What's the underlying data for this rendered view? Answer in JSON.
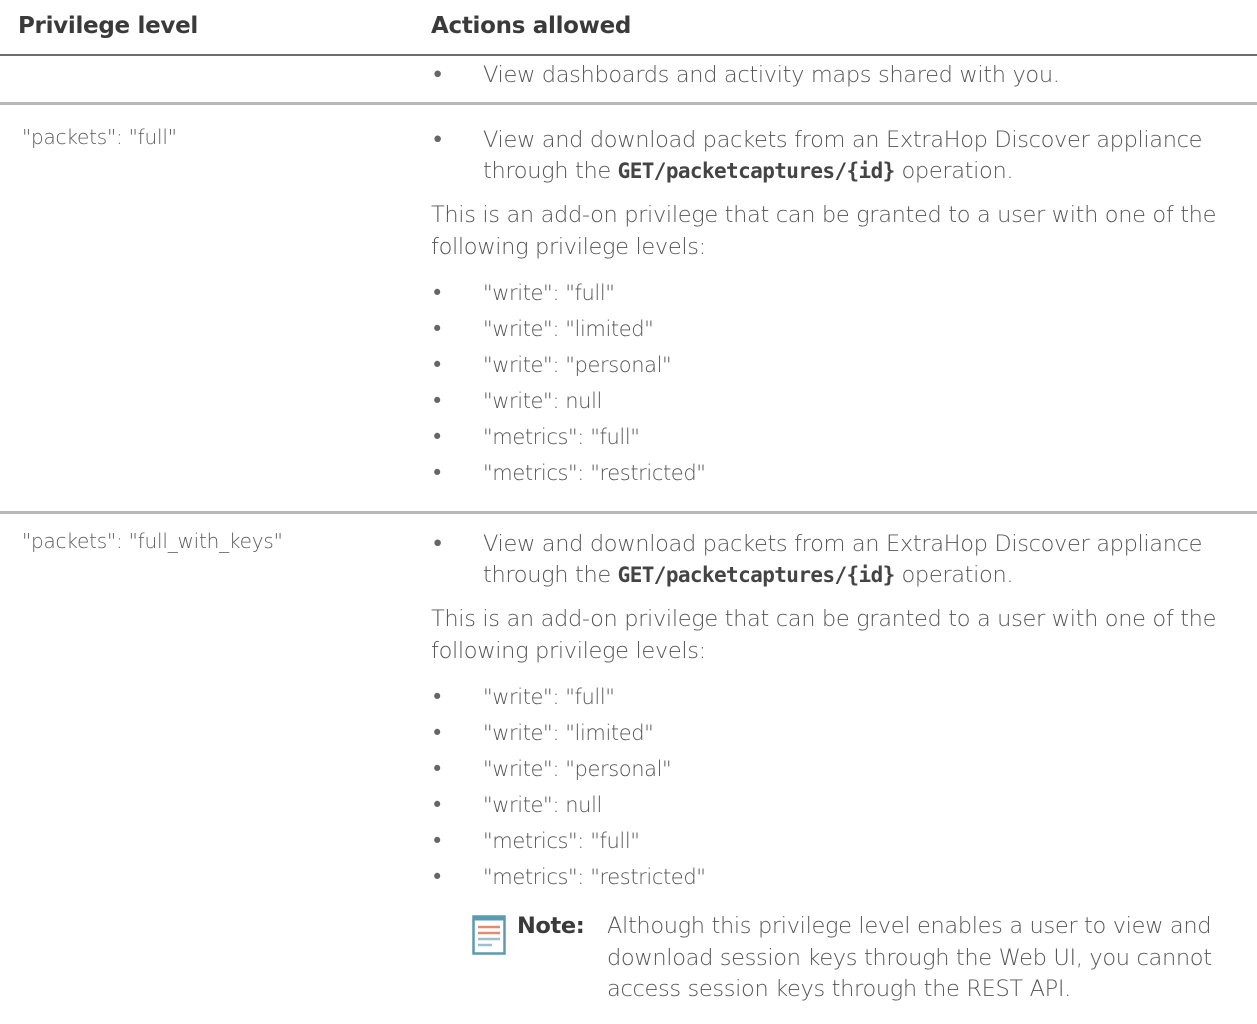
{
  "header": {
    "col_privilege": "Privilege level",
    "col_actions": "Actions allowed"
  },
  "row0": {
    "bullet": "View dashboards and activity maps shared with you."
  },
  "row1": {
    "privilege": "\"packets\": \"full\"",
    "bullet_pre": "View and download packets from an ExtraHop Discover appliance through the ",
    "bullet_code": "GET/packetcaptures/{id}",
    "bullet_post": " operation.",
    "para": "This is an add-on privilege that can be granted to a user with one of the following privilege levels:",
    "levels": [
      "\"write\": \"full\"",
      "\"write\": \"limited\"",
      "\"write\": \"personal\"",
      "\"write\": null",
      "\"metrics\": \"full\"",
      "\"metrics\": \"restricted\""
    ]
  },
  "row2": {
    "privilege": "\"packets\": \"full_with_keys\"",
    "bullet_pre": "View and download packets from an ExtraHop Discover appliance through the ",
    "bullet_code": "GET/packetcaptures/{id}",
    "bullet_post": " operation.",
    "para": "This is an add-on privilege that can be granted to a user with one of the following privilege levels:",
    "levels": [
      "\"write\": \"full\"",
      "\"write\": \"limited\"",
      "\"write\": \"personal\"",
      "\"write\": null",
      "\"metrics\": \"full\"",
      "\"metrics\": \"restricted\""
    ],
    "note_label": "Note:",
    "note_text": "Although this privilege level enables a user to view and download session keys through the Web UI, you cannot access session keys through the REST API."
  },
  "icons": {
    "note": "note-icon"
  },
  "colors": {
    "note_icon_accent": "#e8896f",
    "note_icon_lines": "#9fbfca",
    "note_icon_frame": "#5a9bb0"
  }
}
